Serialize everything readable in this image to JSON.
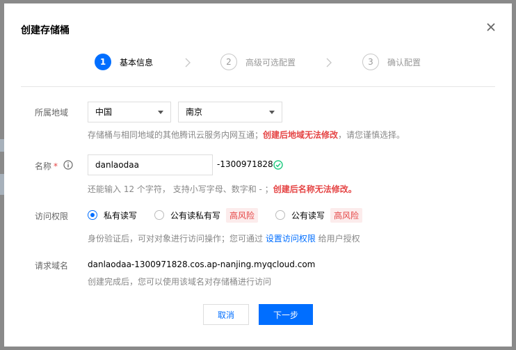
{
  "dialog": {
    "title": "创建存储桶",
    "close_icon": "close-icon"
  },
  "steps": [
    {
      "num": "1",
      "label": "基本信息",
      "active": true
    },
    {
      "num": "2",
      "label": "高级可选配置",
      "active": false
    },
    {
      "num": "3",
      "label": "确认配置",
      "active": false
    }
  ],
  "region": {
    "label": "所属地域",
    "country": "中国",
    "city": "南京",
    "hint_prefix": "存储桶与相同地域的其他腾讯云服务内网互通；",
    "hint_warn": "创建后地域无法修改",
    "hint_suffix": "，请您谨慎选择。"
  },
  "name": {
    "label": "名称",
    "required_mark": "*",
    "info_icon": "info-icon",
    "value": "danlaodaa",
    "suffix": "-1300971828",
    "check_icon": "check-circle-icon",
    "hint_prefix": "还能输入 12 个字符， 支持小写字母、数字和 - ；",
    "hint_warn": "创建后名称无法修改。"
  },
  "access": {
    "label": "访问权限",
    "options": [
      {
        "label": "私有读写",
        "selected": true,
        "risk": ""
      },
      {
        "label": "公有读私有写",
        "selected": false,
        "risk": "高风险"
      },
      {
        "label": "公有读写",
        "selected": false,
        "risk": "高风险"
      }
    ],
    "hint_prefix": "身份验证后，可对对象进行访问操作；您可通过 ",
    "hint_link": "设置访问权限",
    "hint_suffix": " 给用户授权"
  },
  "domain": {
    "label": "请求域名",
    "value": "danlaodaa-1300971828.cos.ap-nanjing.myqcloud.com",
    "hint": "创建完成后，您可以使用该域名对存储桶进行访问"
  },
  "buttons": {
    "cancel": "取消",
    "next": "下一步"
  },
  "colors": {
    "accent": "#006eff",
    "warning": "#e54545"
  }
}
